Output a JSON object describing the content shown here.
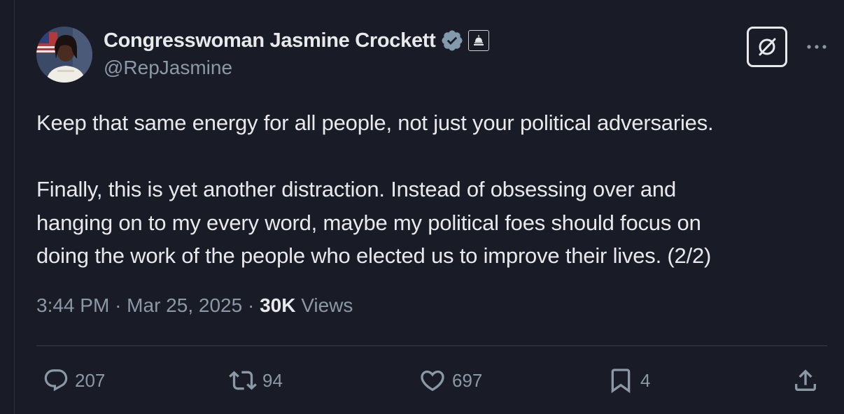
{
  "author": {
    "display_name": "Congresswoman Jasmine Crockett",
    "handle": "@RepJasmine",
    "verified_badge_icon": "verified-badge-icon",
    "affiliation_icon": "capitol-dome-icon"
  },
  "tweet": {
    "paragraph1": "Keep that same energy for all people, not just your political adversaries.",
    "paragraph2_line1": "Finally, this is yet another distraction. Instead of obsessing over and",
    "paragraph2_line2": "hanging on to my every word, maybe my political foes should focus on",
    "paragraph2_line3": "doing the work of the people who elected us to improve their lives. (2/2)"
  },
  "meta": {
    "time": "3:44 PM",
    "separator": "·",
    "date": "Mar 25, 2025",
    "views_count": "30K",
    "views_label": "Views"
  },
  "actions": {
    "replies": "207",
    "reposts": "94",
    "likes": "697",
    "bookmarks": "4"
  },
  "colors": {
    "background": "#191c27",
    "text_primary": "#e7e9ea",
    "text_secondary": "#8b98a5",
    "verified_badge": "#829aab",
    "divider": "#3a3f45"
  }
}
